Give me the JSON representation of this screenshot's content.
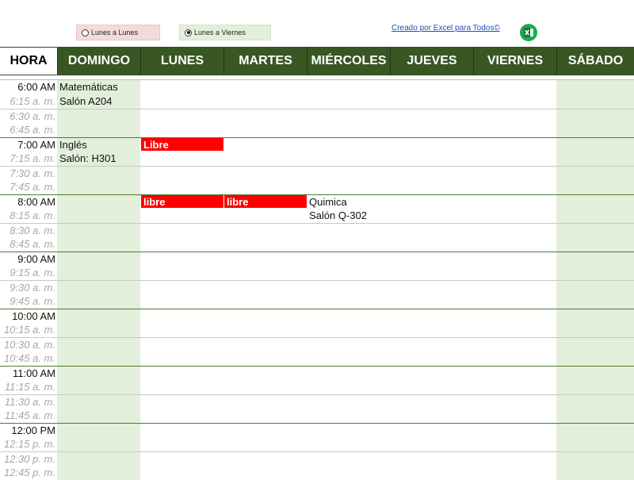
{
  "options": [
    {
      "label": "Lunes a Lunes",
      "selected": false
    },
    {
      "label": "Lunes a Viernes",
      "selected": true
    }
  ],
  "credit": "Creado por Excel para Todos©",
  "excel_icon": "excel-logo-icon",
  "header": {
    "hora": "HORA",
    "days": [
      "DOMINGO",
      "LUNES",
      "MARTES",
      "MIÉRCOLES",
      "JUEVES",
      "VIERNES",
      "SÁBADO"
    ]
  },
  "times": [
    "6:00 AM",
    "6:15 a. m.",
    "6:30 a. m.",
    "6:45 a. m.",
    "7:00 AM",
    "7:15 a. m.",
    "7:30 a. m.",
    "7:45 a. m.",
    "8:00 AM",
    "8:15 a. m.",
    "8:30 a. m.",
    "8:45 a. m.",
    "9:00 AM",
    "9:15 a. m.",
    "9:30 a. m.",
    "9:45 a. m.",
    "10:00 AM",
    "10:15 a. m.",
    "10:30 a. m.",
    "10:45 a. m.",
    "11:00 AM",
    "11:15 a. m.",
    "11:30 a. m.",
    "11:45 a. m.",
    "12:00 PM",
    "12:15 p. m.",
    "12:30 p. m.",
    "12:45 p. m."
  ],
  "entries": {
    "0-1": {
      "text": "Matemáticas"
    },
    "1-1": {
      "text": "Salón A204"
    },
    "4-1": {
      "text": "Inglés"
    },
    "5-1": {
      "text": "Salón: H301"
    },
    "4-2": {
      "text": "Libre",
      "free": true
    },
    "8-2": {
      "text": "libre",
      "free": true
    },
    "8-3": {
      "text": "libre",
      "free": true
    },
    "8-4": {
      "text": "Quimica"
    },
    "9-4": {
      "text": "Salón Q-302"
    }
  },
  "colors": {
    "header_bg": "#385723",
    "weekend_bg": "#e2efda",
    "free_bg": "#ff0000",
    "option1_bg": "#f2dcdb",
    "option2_bg": "#e4efd9"
  }
}
